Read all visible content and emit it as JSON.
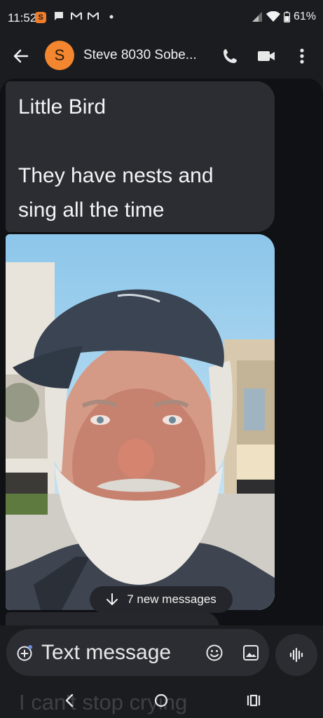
{
  "status_bar": {
    "time": "11:52",
    "app_badge_letter": "S",
    "battery": "61%",
    "icons": [
      "chat-bubble-icon",
      "gmail-icon",
      "gmail-icon",
      "dot-icon",
      "signal-icon",
      "wifi-icon",
      "battery-icon"
    ]
  },
  "app_bar": {
    "avatar_letter": "S",
    "contact_name": "Steve 8030 Sobe...",
    "icons": [
      "back-arrow-icon",
      "phone-icon",
      "video-call-icon",
      "more-vert-icon"
    ]
  },
  "conversation": {
    "message_text": "Little Bird\n\nThey have nests and\nsing all the time",
    "new_messages_label": "7 new messages",
    "ghost_text": "I can't stop crying"
  },
  "composer": {
    "placeholder": "Text message",
    "icons": [
      "add-icon",
      "emoji-icon",
      "image-icon",
      "voice-wave-icon"
    ]
  },
  "nav_bar": {
    "icons": [
      "nav-back-icon",
      "nav-home-icon",
      "nav-recents-icon"
    ]
  },
  "colors": {
    "background": "#1b1c20",
    "bubble": "#2c2d33",
    "avatar": "#f3862f"
  }
}
